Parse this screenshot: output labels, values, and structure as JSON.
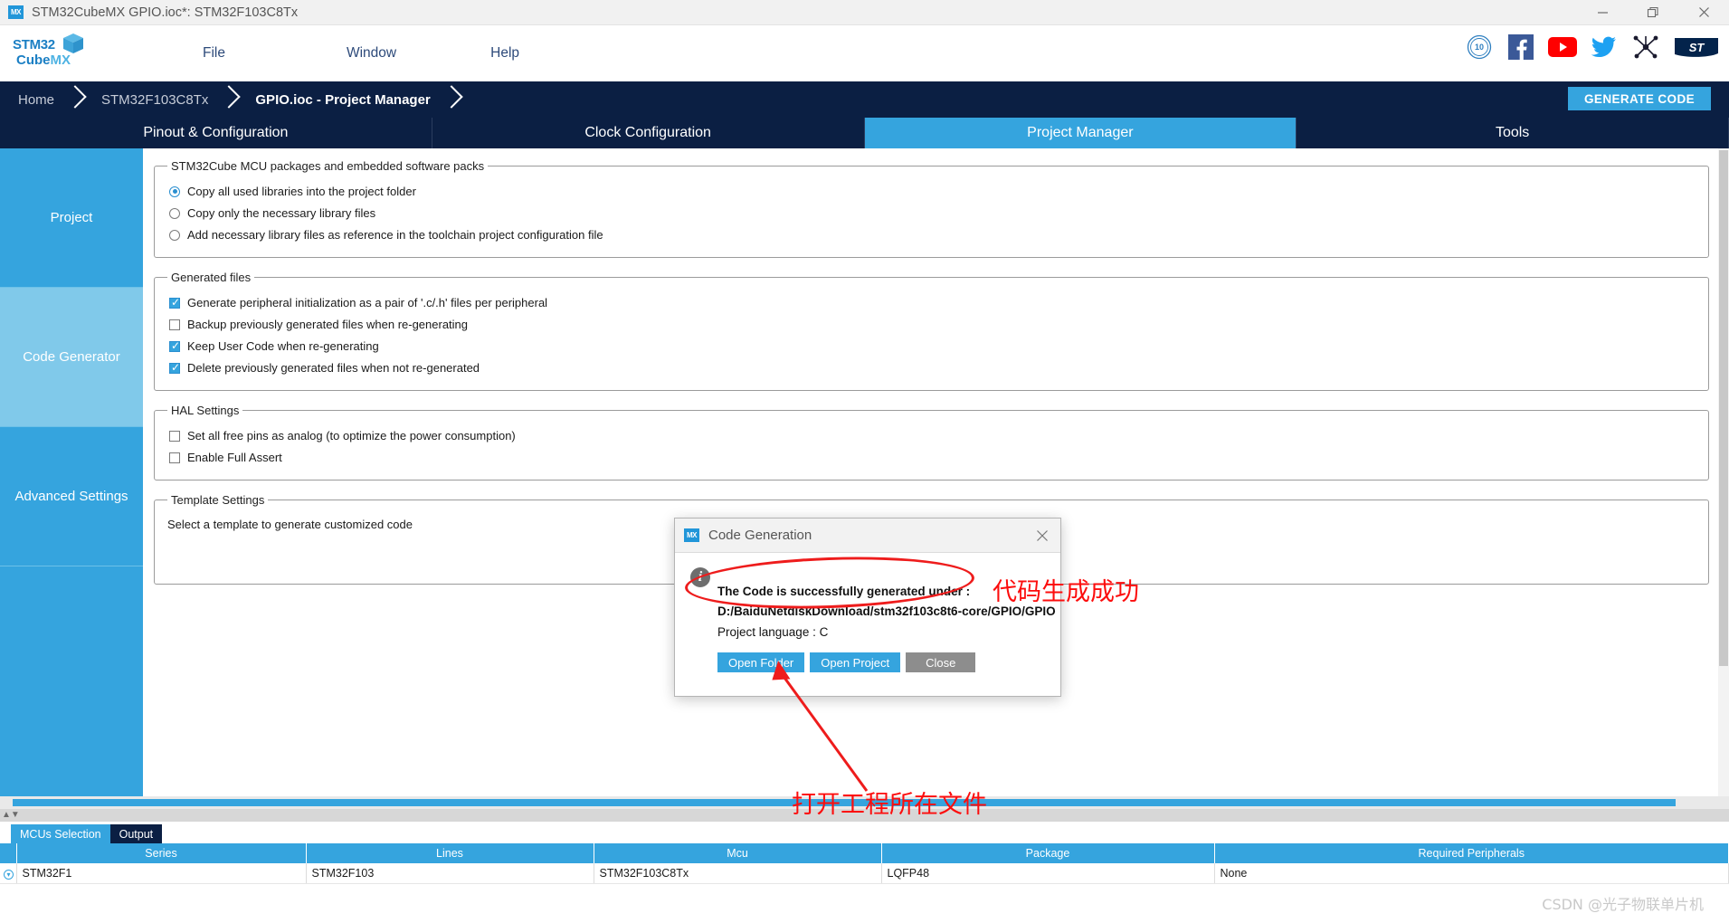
{
  "window": {
    "title": "STM32CubeMX GPIO.ioc*: STM32F103C8Tx",
    "app_icon": "mx-icon",
    "minimize": "—",
    "maximize": "❐",
    "close": "✕"
  },
  "logo": {
    "line1_bold": "STM32",
    "line1_light": "32",
    "line2_bold": "Cube",
    "line2_light": "MX"
  },
  "menu": {
    "file": "File",
    "window": "Window",
    "help": "Help"
  },
  "social": [
    {
      "name": "ten-years-badge-icon",
      "label": "10"
    },
    {
      "name": "facebook-icon",
      "label": "f"
    },
    {
      "name": "youtube-icon",
      "label": "▶"
    },
    {
      "name": "twitter-icon",
      "label": "twitter"
    },
    {
      "name": "community-icon",
      "label": "community"
    },
    {
      "name": "st-logo-icon",
      "label": "ST"
    }
  ],
  "breadcrumb": {
    "items": [
      {
        "label": "Home",
        "active": false
      },
      {
        "label": "STM32F103C8Tx",
        "active": false
      },
      {
        "label": "GPIO.ioc - Project Manager",
        "active": true
      }
    ],
    "generate_code": "GENERATE CODE"
  },
  "main_tabs": [
    {
      "label": "Pinout & Configuration",
      "active": false
    },
    {
      "label": "Clock Configuration",
      "active": false
    },
    {
      "label": "Project Manager",
      "active": true
    },
    {
      "label": "Tools",
      "active": false
    }
  ],
  "sidebar": {
    "items": [
      {
        "label": "Project",
        "active": false
      },
      {
        "label": "Code Generator",
        "active": true
      },
      {
        "label": "Advanced Settings",
        "active": false
      }
    ]
  },
  "groups": {
    "packages": {
      "legend": "STM32Cube MCU packages and embedded software packs",
      "options": [
        {
          "label": "Copy all used libraries into the project folder",
          "selected": true
        },
        {
          "label": "Copy only the necessary library files",
          "selected": false
        },
        {
          "label": "Add necessary library files as reference in the toolchain project configuration file",
          "selected": false
        }
      ]
    },
    "generated_files": {
      "legend": "Generated files",
      "options": [
        {
          "label": "Generate peripheral initialization as a pair of '.c/.h' files per peripheral",
          "checked": true
        },
        {
          "label": "Backup previously generated files when re-generating",
          "checked": false
        },
        {
          "label": "Keep User Code when re-generating",
          "checked": true
        },
        {
          "label": "Delete previously generated files when not re-generated",
          "checked": true
        }
      ]
    },
    "hal_settings": {
      "legend": "HAL Settings",
      "options": [
        {
          "label": "Set all free pins as analog (to optimize the power consumption)",
          "checked": false
        },
        {
          "label": "Enable Full Assert",
          "checked": false
        }
      ]
    },
    "template_settings": {
      "legend": "Template Settings",
      "text": "Select a template to generate customized code"
    }
  },
  "dialog": {
    "icon": "mx-icon",
    "title": "Code Generation",
    "close": "✕",
    "info_icon": "info-icon",
    "line1": "The Code is successfully generated under :",
    "line2": "D:/BaiduNetdiskDownload/stm32f103c8t6-core/GPIO/GPIO",
    "line3": "Project language : C",
    "buttons": {
      "open_folder": "Open Folder",
      "open_project": "Open Project",
      "close": "Close"
    }
  },
  "annotations": {
    "success_note": "代码生成成功",
    "open_folder_note": "打开工程所在文件",
    "ellipse_color": "#ee1c1c",
    "arrow_color": "#ee1c1c"
  },
  "bottom": {
    "tabs": [
      {
        "label": "MCUs Selection",
        "selected": true
      },
      {
        "label": "Output",
        "selected": false
      }
    ],
    "table": {
      "columns": [
        "Series",
        "Lines",
        "Mcu",
        "Package",
        "Required Peripherals"
      ],
      "rows": [
        [
          "STM32F1",
          "STM32F103",
          "STM32F103C8Tx",
          "LQFP48",
          "None"
        ]
      ]
    }
  },
  "watermark": "CSDN @光子物联单片机",
  "colors": {
    "accent_blue": "#35a4de",
    "dark_navy": "#0b1f43",
    "light_blue_active": "#80c9ea",
    "annotation_red": "#fc0d0d"
  }
}
